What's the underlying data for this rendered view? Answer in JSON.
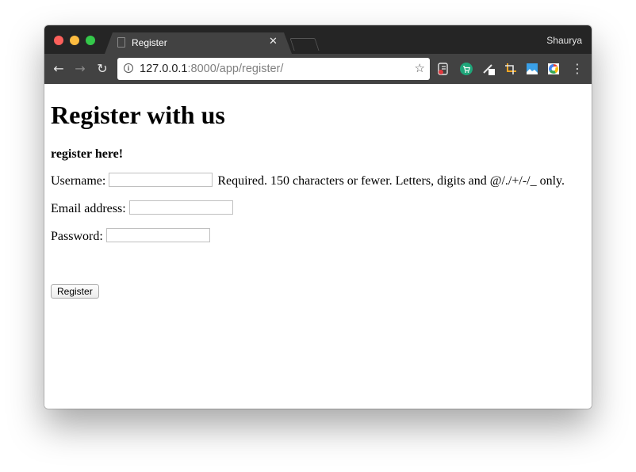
{
  "browser": {
    "profile_name": "Shaurya",
    "tab": {
      "title": "Register",
      "close_glyph": "✕"
    },
    "address_bar": {
      "host": "127.0.0.1",
      "rest": ":8000/app/register/"
    },
    "nav": {
      "back_glyph": "←",
      "forward_glyph": "→",
      "reload_glyph": "↻"
    },
    "extension_icons": [
      "evernote-clipper-icon",
      "shopping-cart-icon",
      "pen-tool-icon",
      "crop-icon",
      "image-icon",
      "google-extension-icon"
    ],
    "star_glyph": "☆",
    "menu_glyph": "⋮"
  },
  "page": {
    "title": "Register with us",
    "subtitle": "register here!",
    "form": {
      "username_label": "Username:",
      "username_help": "Required. 150 characters or fewer. Letters, digits and @/./+/-/_ only.",
      "username_value": "",
      "email_label": "Email address:",
      "email_value": "",
      "password_label": "Password:",
      "password_value": "",
      "submit_label": "Register"
    }
  },
  "colors": {
    "tabstrip_bg": "#252525",
    "toolbar_bg": "#424242",
    "close_red": "#fc605b",
    "minimize_yellow": "#fdbc40",
    "zoom_green": "#34c84a"
  }
}
